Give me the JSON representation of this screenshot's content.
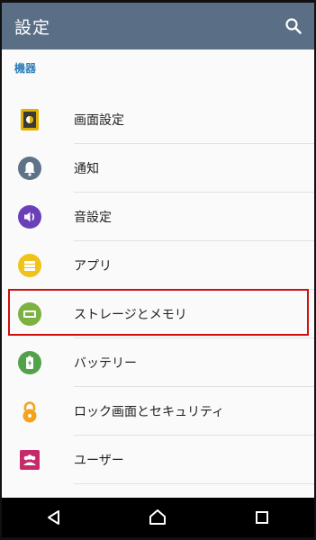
{
  "appbar": {
    "title": "設定",
    "search_icon": "search-icon"
  },
  "section": {
    "title": "機器"
  },
  "items": [
    {
      "label": "画面設定",
      "icon": "display-icon",
      "color": "#e0b100"
    },
    {
      "label": "通知",
      "icon": "bell-icon",
      "color": "#5f7388"
    },
    {
      "label": "音設定",
      "icon": "volume-icon",
      "color": "#6b3fb8"
    },
    {
      "label": "アプリ",
      "icon": "apps-icon",
      "color": "#f0c21a"
    },
    {
      "label": "ストレージとメモリ",
      "icon": "storage-icon",
      "color": "#7bb241"
    },
    {
      "label": "バッテリー",
      "icon": "battery-icon",
      "color": "#52a24a"
    },
    {
      "label": "ロック画面とセキュリティ",
      "icon": "lock-icon",
      "color": "#f3a41a"
    },
    {
      "label": "ユーザー",
      "icon": "users-icon",
      "color": "#c62a6a"
    }
  ],
  "navbar": {
    "back_icon": "back-icon",
    "home_icon": "home-icon",
    "recents_icon": "recents-icon"
  }
}
